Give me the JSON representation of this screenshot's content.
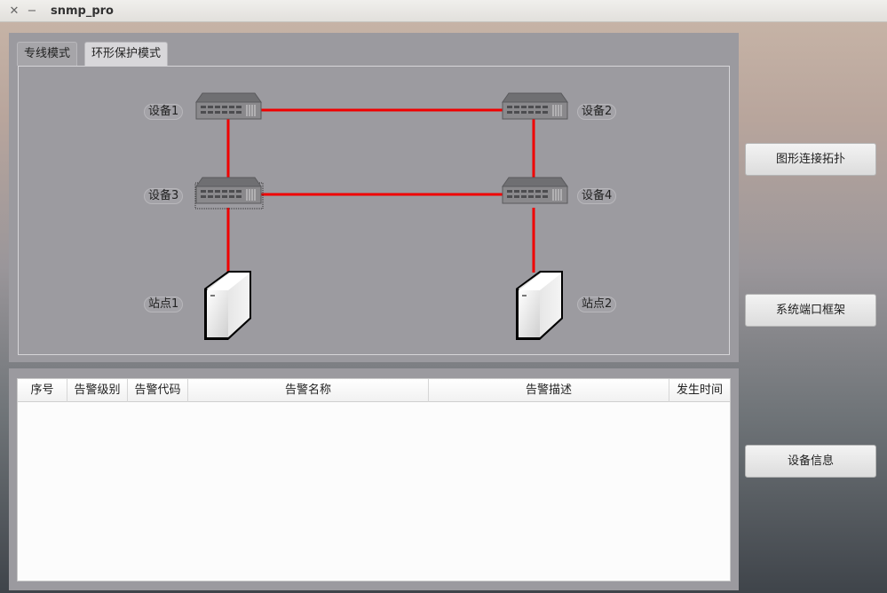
{
  "window": {
    "title": "snmp_pro",
    "close_symbol": "✕",
    "minimize_symbol": "−"
  },
  "tabs": [
    {
      "label": "专线模式",
      "active": false
    },
    {
      "label": "环形保护模式",
      "active": true
    }
  ],
  "topology": {
    "link_color": "#f00000",
    "nodes": [
      {
        "label": "设备1",
        "type": "switch-icon"
      },
      {
        "label": "设备2",
        "type": "switch-icon"
      },
      {
        "label": "设备3",
        "type": "switch-icon"
      },
      {
        "label": "设备4",
        "type": "switch-icon"
      },
      {
        "label": "站点1",
        "type": "server-icon"
      },
      {
        "label": "站点2",
        "type": "server-icon"
      }
    ]
  },
  "alarm_table": {
    "columns": [
      "序号",
      "告警级别",
      "告警代码",
      "告警名称",
      "告警描述",
      "发生时间"
    ],
    "rows": []
  },
  "side_buttons": {
    "topology": "图形连接拓扑",
    "ports": "系统端口框架",
    "device_info": "设备信息"
  }
}
